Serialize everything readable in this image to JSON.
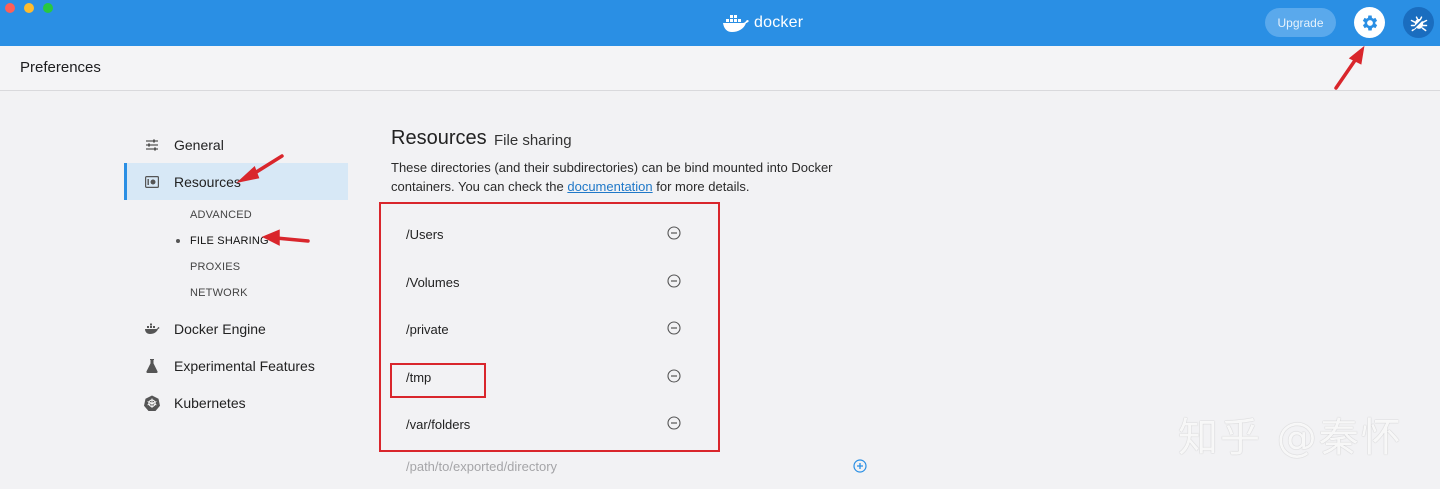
{
  "titlebar": {
    "logo_text": "docker",
    "upgrade_label": "Upgrade",
    "settings_icon": "gear-icon",
    "troubleshoot_icon": "bug-icon",
    "accent_color": "#2a8fe4"
  },
  "header": {
    "title": "Preferences"
  },
  "sidebar": {
    "items": [
      {
        "label": "General",
        "icon": "sliders-icon"
      },
      {
        "label": "Resources",
        "icon": "resources-icon",
        "active": true
      },
      {
        "label": "Docker Engine",
        "icon": "whale-icon"
      },
      {
        "label": "Experimental Features",
        "icon": "flask-icon"
      },
      {
        "label": "Kubernetes",
        "icon": "kubernetes-icon"
      }
    ],
    "sub_items": [
      {
        "label": "ADVANCED"
      },
      {
        "label": "FILE SHARING",
        "active": true
      },
      {
        "label": "PROXIES"
      },
      {
        "label": "NETWORK"
      }
    ]
  },
  "main": {
    "title": "Resources",
    "subtitle": "File sharing",
    "description_before": "These directories (and their subdirectories) can be bind mounted into Docker containers. You can check the ",
    "description_link": "documentation",
    "description_after": " for more details.",
    "directories": [
      {
        "path": "/Users"
      },
      {
        "path": "/Volumes"
      },
      {
        "path": "/private"
      },
      {
        "path": "/tmp"
      },
      {
        "path": "/var/folders"
      }
    ],
    "new_directory_placeholder": "/path/to/exported/directory"
  },
  "watermark": "知乎 @秦怀"
}
